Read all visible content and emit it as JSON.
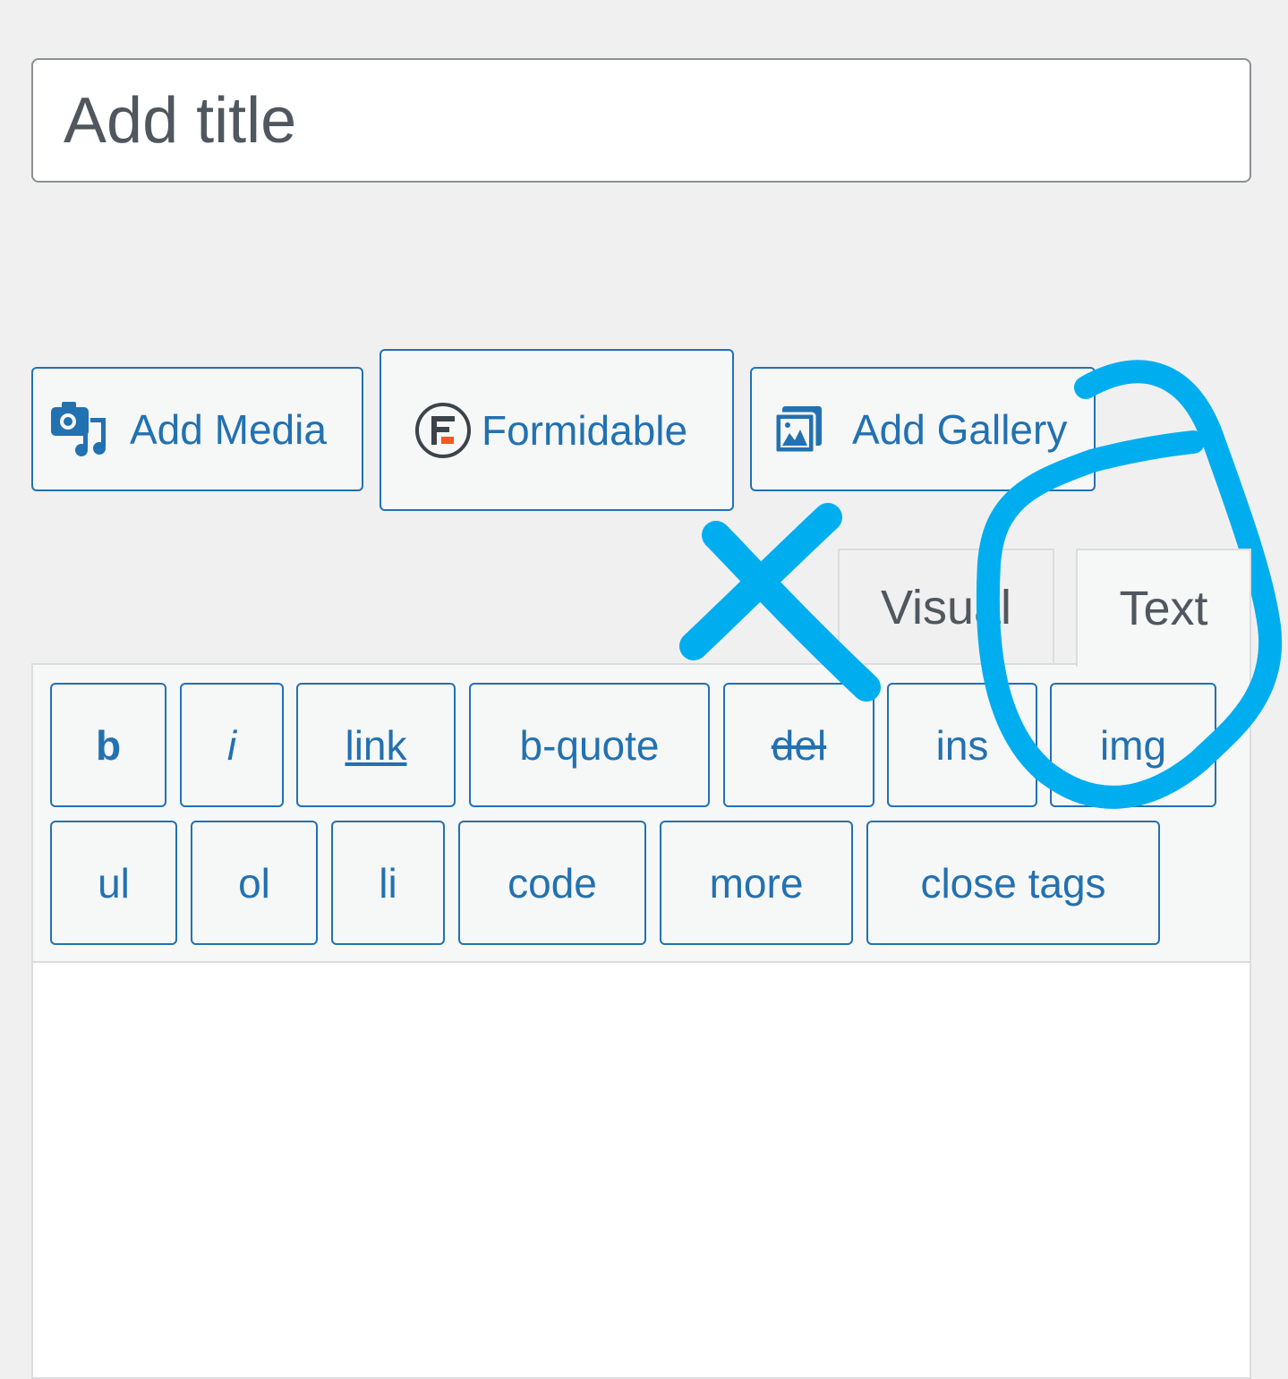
{
  "title": {
    "placeholder": "Add title"
  },
  "media_buttons": [
    {
      "label": "Add Media",
      "icon": "add-media-icon"
    },
    {
      "label": "Formidable",
      "icon": "formidable-icon"
    },
    {
      "label": "Add Gallery",
      "icon": "gallery-icon"
    }
  ],
  "tabs": {
    "visual": "Visual",
    "text": "Text",
    "active": "text"
  },
  "quicktags": {
    "row1": [
      "b",
      "i",
      "link",
      "b-quote",
      "del",
      "ins",
      "img"
    ],
    "row2": [
      "ul",
      "ol",
      "li",
      "code",
      "more",
      "close tags"
    ]
  },
  "content": {
    "value": ""
  },
  "annotations": {
    "color": "#00aeef",
    "marks": [
      "x-mark",
      "circle-mark"
    ]
  }
}
